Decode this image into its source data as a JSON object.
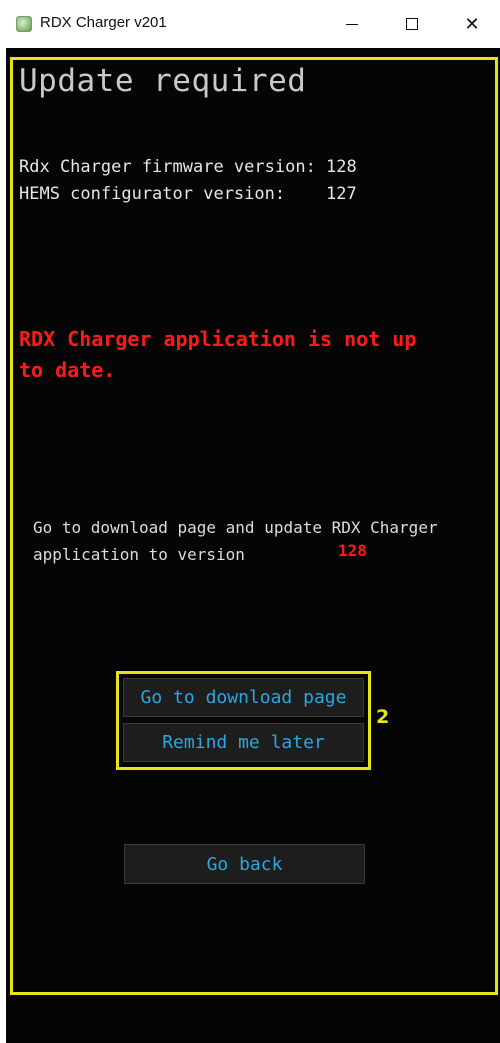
{
  "window": {
    "title": "RDX Charger v201",
    "controls": {
      "minimize": "–",
      "maximize": "",
      "close": "✕"
    }
  },
  "page": {
    "title": "Update required",
    "firmware_line": "Rdx Charger firmware version: 128",
    "hems_line": "HEMS configurator version:    127",
    "warning": "RDX Charger application is not up to date.",
    "instruction": "Go to download page and update RDX Charger application to version",
    "target_version": "128"
  },
  "buttons": {
    "download": "Go to download page",
    "remind": "Remind me later",
    "back": "Go back"
  },
  "annotation": {
    "number": "2"
  },
  "colors": {
    "background": "#050505",
    "title_text": "#c9c9c9",
    "warning": "#ff1a1a",
    "button_text": "#2aa6e0",
    "annotation_yellow": "#e4e417"
  }
}
